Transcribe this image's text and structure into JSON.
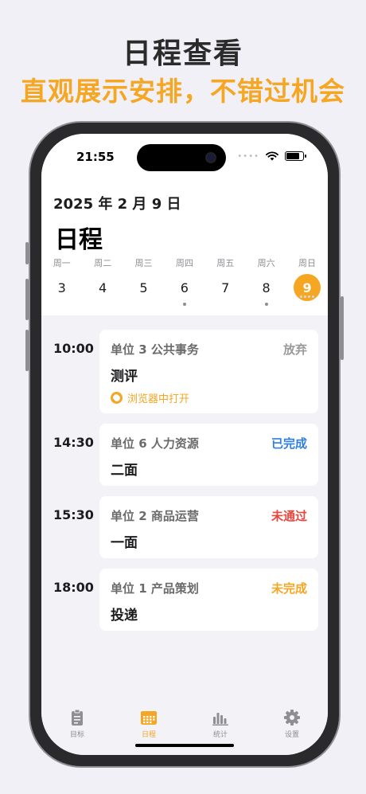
{
  "promo": {
    "title": "日程查看",
    "subtitle": "直观展示安排，不错过机会"
  },
  "status_bar": {
    "time": "21:55",
    "icons": [
      "signal-dots-icon",
      "wifi-icon",
      "battery-icon"
    ]
  },
  "header": {
    "date": "2025 年 2 月 9 日",
    "title": "日程"
  },
  "week": [
    {
      "label": "周一",
      "num": "3",
      "dot": false,
      "selected": false
    },
    {
      "label": "周二",
      "num": "4",
      "dot": false,
      "selected": false
    },
    {
      "label": "周三",
      "num": "5",
      "dot": false,
      "selected": false
    },
    {
      "label": "周四",
      "num": "6",
      "dot": true,
      "selected": false
    },
    {
      "label": "周五",
      "num": "7",
      "dot": false,
      "selected": false
    },
    {
      "label": "周六",
      "num": "8",
      "dot": true,
      "selected": false
    },
    {
      "label": "周日",
      "num": "9",
      "dot": true,
      "selected": true
    }
  ],
  "events": [
    {
      "time": "10:00",
      "company": "单位 3 公共事务",
      "status": "放弃",
      "status_color": "#9a9a9a",
      "stage": "测评",
      "link": "浏览器中打开"
    },
    {
      "time": "14:30",
      "company": "单位 6 人力资源",
      "status": "已完成",
      "status_color": "#2f7fe0",
      "stage": "二面"
    },
    {
      "time": "15:30",
      "company": "单位 2 商品运营",
      "status": "未通过",
      "status_color": "#e8453c",
      "stage": "一面"
    },
    {
      "time": "18:00",
      "company": "单位 1 产品策划",
      "status": "未完成",
      "status_color": "#f5a623",
      "stage": "投递"
    }
  ],
  "tabs": [
    {
      "label": "目标",
      "icon": "clipboard-icon",
      "active": false
    },
    {
      "label": "日程",
      "icon": "calendar-icon",
      "active": true
    },
    {
      "label": "统计",
      "icon": "bar-chart-icon",
      "active": false
    },
    {
      "label": "设置",
      "icon": "gear-icon",
      "active": false
    }
  ],
  "colors": {
    "accent": "#f5a623",
    "inactive": "#8e8e93"
  }
}
